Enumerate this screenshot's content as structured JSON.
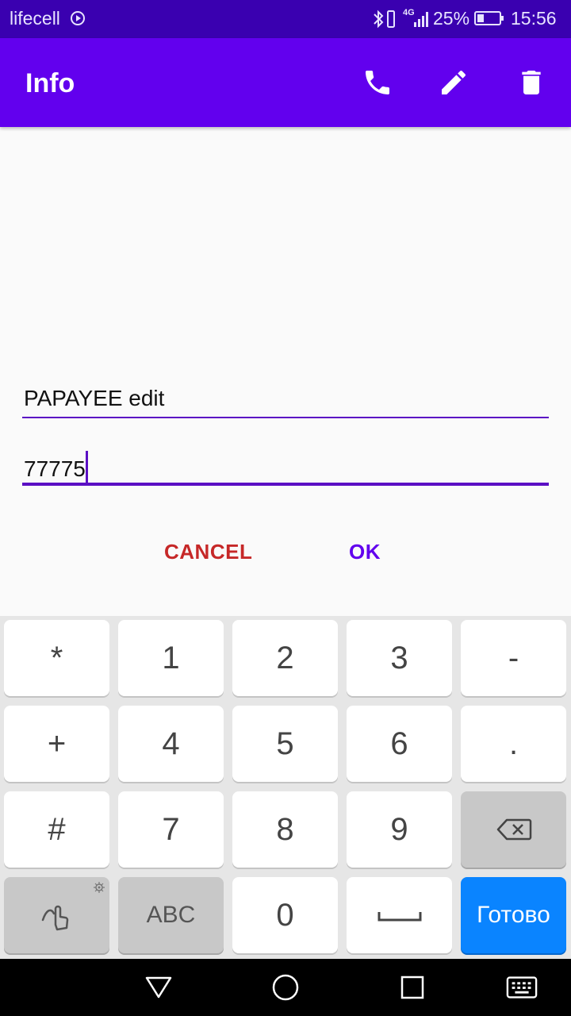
{
  "status_bar": {
    "carrier": "lifecell",
    "network": "4G",
    "battery_percent": "25%",
    "time": "15:56"
  },
  "app_bar": {
    "title": "Info",
    "actions": [
      "phone-icon",
      "edit-icon",
      "delete-icon"
    ],
    "color": "#6200ee"
  },
  "dialog": {
    "name_value": "PAPAYEE edit",
    "number_value": "77775",
    "cancel_label": "CANCEL",
    "ok_label": "OK",
    "cancel_color": "#c62828",
    "ok_color": "#6200ee"
  },
  "keyboard": {
    "rows": [
      [
        "*",
        "1",
        "2",
        "3",
        "-"
      ],
      [
        "+",
        "4",
        "5",
        "6",
        "."
      ],
      [
        "#",
        "7",
        "8",
        "9",
        "backspace-icon"
      ],
      [
        "gesture-icon",
        "ABC",
        "0",
        "space-icon",
        "Готово"
      ]
    ],
    "done_label": "Готово",
    "abc_label": "ABC"
  },
  "nav_bar": {
    "buttons": [
      "back-icon",
      "home-icon",
      "recents-icon",
      "keyboard-icon"
    ]
  }
}
